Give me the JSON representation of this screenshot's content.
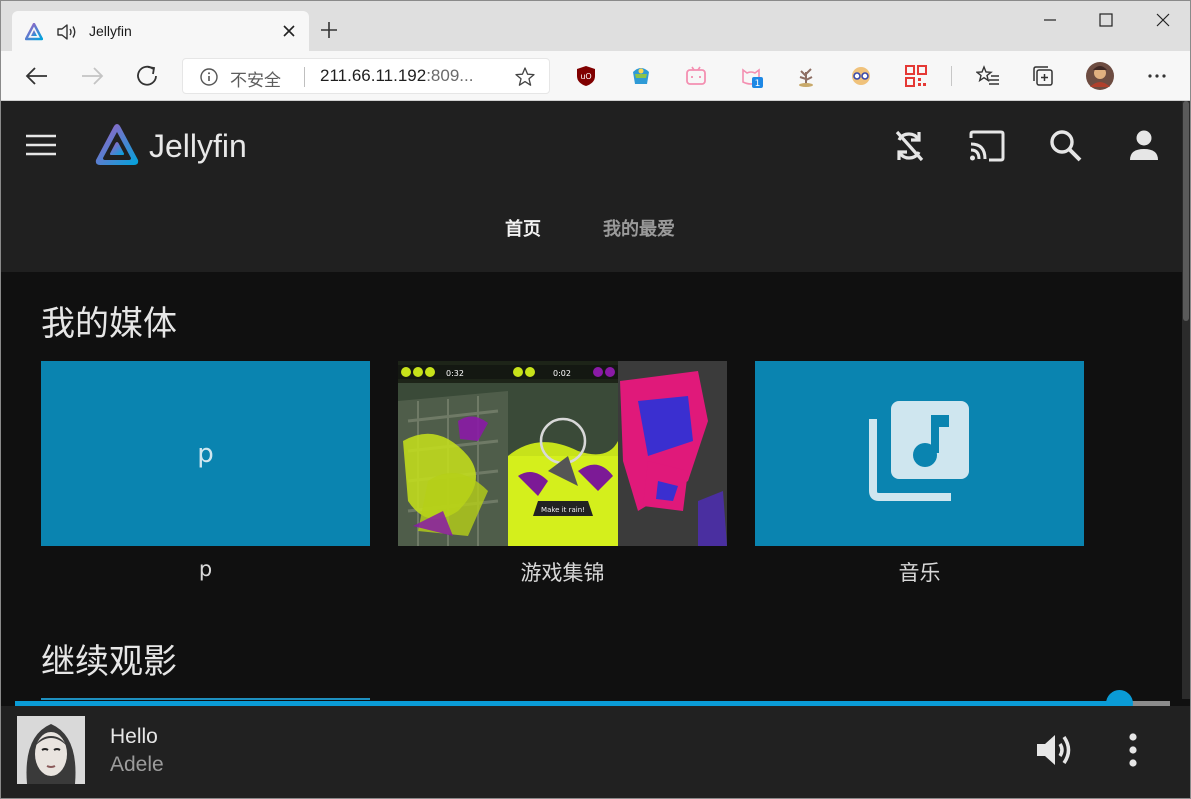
{
  "browser": {
    "tab_title": "Jellyfin",
    "address_security": "不安全",
    "address_host": "211.66.11.192",
    "address_rest": ":809...",
    "extension_badge": "1"
  },
  "app": {
    "logo_text": "Jellyfin",
    "tabs": [
      {
        "label": "首页",
        "active": true
      },
      {
        "label": "我的最爱",
        "active": false
      }
    ]
  },
  "sections": [
    {
      "title": "我的媒体",
      "cards": [
        {
          "label": "p",
          "center_text": "p",
          "type": "folder-letter"
        },
        {
          "label": "游戏集锦",
          "type": "video-thumbnail"
        },
        {
          "label": "音乐",
          "type": "music-library"
        }
      ]
    },
    {
      "title": "继续观影"
    }
  ],
  "player": {
    "track_title": "Hello",
    "artist": "Adele",
    "progress_fraction": 0.956
  },
  "colors": {
    "accent": "#0a9bd6",
    "card_blue": "#0a84b0",
    "header_bg": "#202020",
    "page_bg": "#101010"
  }
}
